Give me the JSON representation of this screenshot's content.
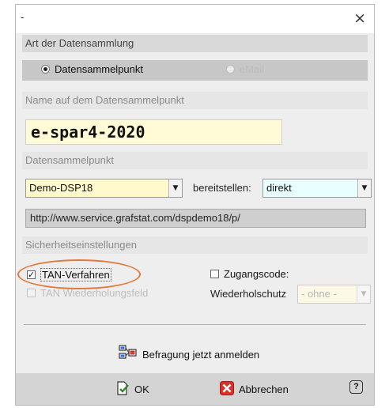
{
  "window": {
    "title": "-",
    "close_symbol": "×"
  },
  "collection_type": {
    "heading": "Art der Datensammlung",
    "options": [
      {
        "label": "Datensammelpunkt",
        "selected": true,
        "enabled": true
      },
      {
        "label": "eMail",
        "selected": false,
        "enabled": false
      }
    ]
  },
  "name_section": {
    "heading": "Name auf dem Datensammelpunkt",
    "value": "e-spar4-2020"
  },
  "dsp_section": {
    "heading": "Datensammelpunkt",
    "dsp_select": "Demo-DSP18",
    "provide_label": "bereitstellen:",
    "provide_select": "direkt",
    "url": "http://www.service.grafstat.com/dspdemo18/p/"
  },
  "security": {
    "heading": "Sicherheitseinstellungen",
    "tan": {
      "label": "TAN-Verfahren",
      "checked": true,
      "mark": "✓"
    },
    "tan_repeat": {
      "label": "TAN Wiederholungsfeld",
      "checked": false,
      "enabled": false
    },
    "access_code": {
      "label": "Zugangscode:",
      "checked": false
    },
    "repeat_protection_label": "Wiederholschutz",
    "repeat_protection_value": "- ohne -"
  },
  "register_label": "Befragung jetzt anmelden",
  "footer": {
    "ok_label": "OK",
    "cancel_label": "Abbrechen",
    "help_symbol": "?"
  },
  "colors": {
    "highlight_ellipse": "#e37a3c",
    "field_yellow": "#fffbd6",
    "field_cyan": "#e9ffff"
  }
}
